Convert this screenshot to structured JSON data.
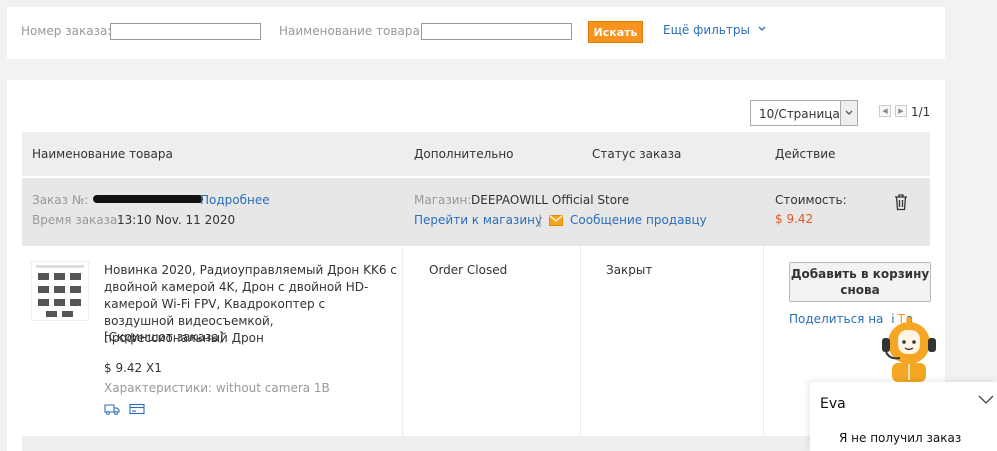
{
  "filters": {
    "order_number_label": "Номер заказа:",
    "order_number_value": "",
    "product_name_label": "Наименование товара:",
    "product_name_value": "",
    "search_button": "Искать",
    "more_filters": "Ещё фильтры"
  },
  "pager": {
    "per_page": "10/Страница",
    "page_count": "1/1"
  },
  "table_headers": {
    "product": "Наименование товара",
    "additional": "Дополнительно",
    "status": "Статус заказа",
    "action": "Действие"
  },
  "order": {
    "order_no_label": "Заказ №:",
    "details_link": "Подробнее",
    "order_time_label": "Время заказа:",
    "order_time": "13:10 Nov. 11 2020",
    "store_label": "Магазин:",
    "store_name": "DEEPAOWILL Official Store",
    "go_to_store": "Перейти к магазину",
    "separator": "|",
    "message_seller": "Сообщение продавцу",
    "cost_label": "Стоимость:",
    "cost": "$ 9.42",
    "item": {
      "title": "Новинка 2020, Радиоуправляемый Дрон KK6 с двойной камерой 4K, Дрон с двойной HD-камерой Wi-Fi FPV, Квадрокоптер с воздушной видеосъемкой, профессиональный Дрон",
      "screenshot": "[Скриншот заказа]",
      "price_qty": "$ 9.42 X1",
      "attributes": "Характеристики: without camera 1B",
      "additional_status": "Order Closed",
      "order_status": "Закрыт",
      "add_to_cart": "Добавить в корзину снова",
      "share_label": "Поделиться на"
    }
  },
  "chat": {
    "name": "Eva",
    "message": "Я не получил заказ"
  },
  "colors": {
    "accent_orange": "#f7941d",
    "link_blue": "#2a6ebb",
    "price_red": "#e25822"
  }
}
